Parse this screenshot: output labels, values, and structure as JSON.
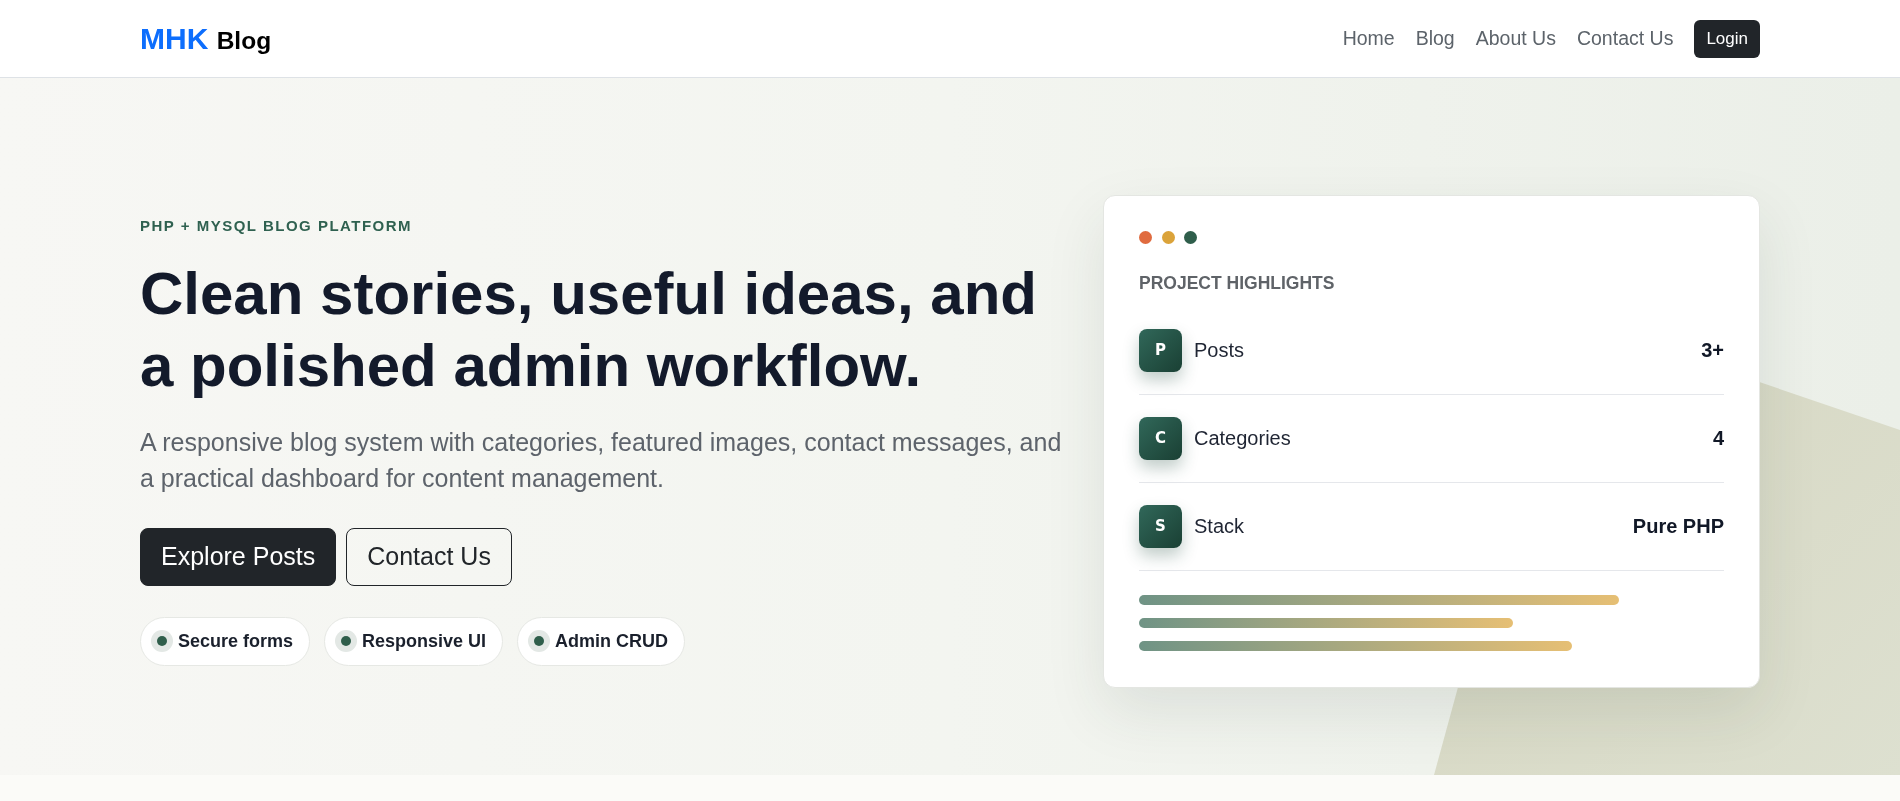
{
  "header": {
    "logo": {
      "primary": "MHK",
      "secondary": "Blog"
    },
    "nav": [
      {
        "label": "Home"
      },
      {
        "label": "Blog"
      },
      {
        "label": "About Us"
      },
      {
        "label": "Contact Us"
      }
    ],
    "login_button": "Login"
  },
  "hero": {
    "eyebrow": "PHP + MYSQL BLOG PLATFORM",
    "title": "Clean stories, useful ideas, and a polished admin workflow.",
    "description": "A responsive blog system with categories, featured images, contact messages, and a practical dashboard for content management.",
    "buttons": [
      {
        "label": "Explore Posts",
        "kind": "primary"
      },
      {
        "label": "Contact Us",
        "kind": "outline"
      }
    ],
    "features": [
      "Secure forms",
      "Responsive UI",
      "Admin CRUD"
    ]
  },
  "highlights_card": {
    "title": "PROJECT HIGHLIGHTS",
    "rows": [
      {
        "initial": "P",
        "label": "Posts",
        "value": "3+"
      },
      {
        "initial": "C",
        "label": "Categories",
        "value": "4"
      },
      {
        "initial": "S",
        "label": "Stack",
        "value": "Pure PHP"
      }
    ]
  }
}
